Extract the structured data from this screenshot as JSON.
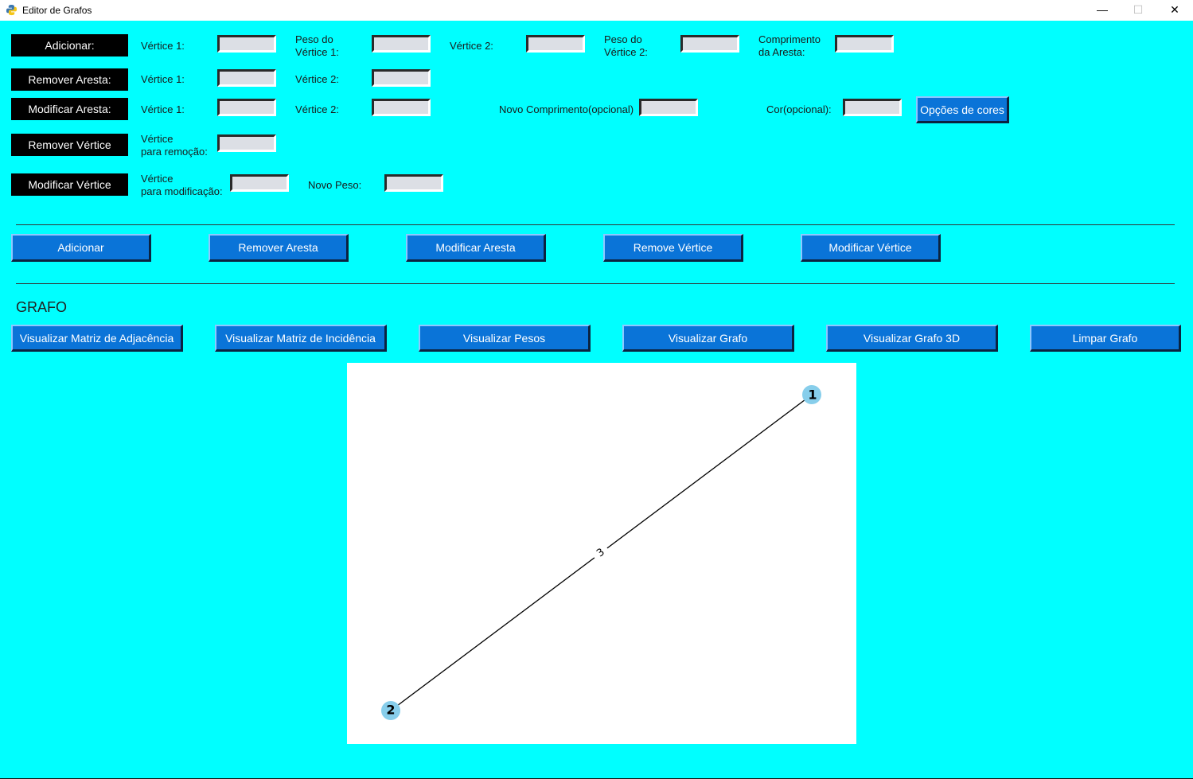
{
  "window": {
    "title": "Editor de Grafos",
    "minimize": "—",
    "maximize": "☐",
    "close": "✕"
  },
  "colors": {
    "background": "#00ffff",
    "button": "#0a74d8",
    "node": "#87ceeb"
  },
  "forms": {
    "add": {
      "label": "Adicionar:",
      "v1_label": "Vértice 1:",
      "w1_label": [
        "Peso do",
        "Vértice 1:"
      ],
      "v2_label": "Vértice 2:",
      "w2_label": [
        "Peso do",
        "Vértice 2:"
      ],
      "len_label": [
        "Comprimento",
        "da Aresta:"
      ]
    },
    "remove_edge": {
      "label": "Remover Aresta:",
      "v1_label": "Vértice 1:",
      "v2_label": "Vértice 2:"
    },
    "modify_edge": {
      "label": "Modificar Aresta:",
      "v1_label": "Vértice 1:",
      "v2_label": "Vértice 2:",
      "new_len_label": "Novo Comprimento(opcional)",
      "color_label": "Cor(opcional):",
      "color_button": "Opções de cores"
    },
    "remove_vertex": {
      "label": "Remover Vértice",
      "vertex_label": [
        "Vértice",
        "para remoção:"
      ]
    },
    "modify_vertex": {
      "label": "Modificar Vértice",
      "vertex_label": [
        "Vértice",
        "para modificação:"
      ],
      "new_weight_label": "Novo Peso:"
    }
  },
  "actions": [
    "Adicionar",
    "Remover Aresta",
    "Modificar Aresta",
    "Remove Vértice",
    "Modificar Vértice"
  ],
  "graph_section": {
    "title": "GRAFO",
    "buttons": [
      "Visualizar Matriz de Adjacência",
      "Visualizar Matriz de Incidência",
      "Visualizar Pesos",
      "Visualizar Grafo",
      "Visualizar Grafo 3D",
      "Limpar Grafo"
    ]
  },
  "graph": {
    "nodes": [
      {
        "label": "1"
      },
      {
        "label": "2"
      }
    ],
    "edges": [
      {
        "from": "1",
        "to": "2",
        "label": "3"
      }
    ]
  }
}
